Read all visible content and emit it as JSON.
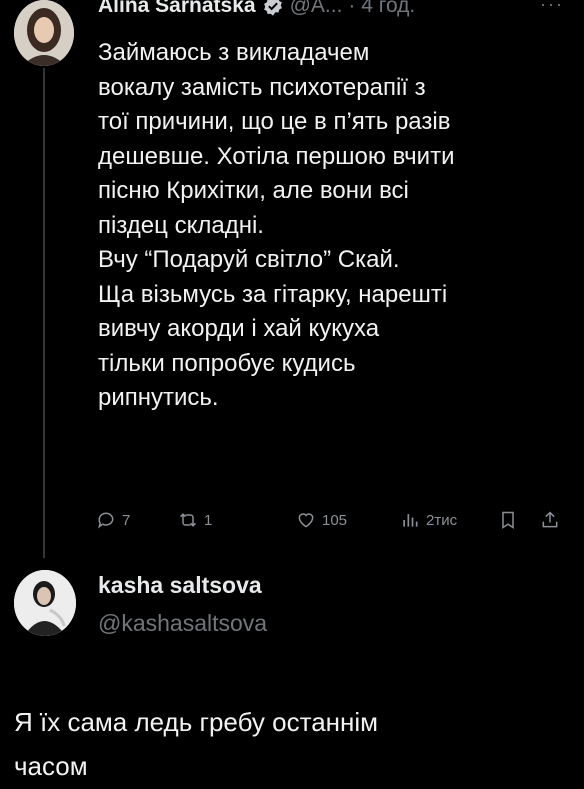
{
  "tweet": {
    "author_name": "Alina Sarnatska",
    "verified_icon": "verified-badge-icon",
    "handle": "@A...",
    "time": "· 4 год.",
    "more_icon": "more-icon",
    "text": "Займаюсь з викладачем\nвокалу замість психотерапії з\nтої причини, що це в п’ять разів\nдешевше. Хотіла першою вчити\nпісню Крихітки, але вони всі\nпіздец складні.\nВчу “Подаруй світло” Скай.\nЩа візьмусь за гітарку, нарешті\nвивчу акорди і хай кукуха\nтільки попробує кудись\nрипнутись.",
    "actions": {
      "replies": "7",
      "retweets": "1",
      "likes": "105",
      "views": "2тис"
    }
  },
  "reply": {
    "author_name": "kasha saltsova",
    "handle": "@kashasaltsova",
    "text": "Я їх сама ледь гребу останнім\nчасом"
  },
  "colors": {
    "background": "#000000",
    "text": "#e7e9ea",
    "muted": "#71767b",
    "verified": "#1d9bf0"
  }
}
